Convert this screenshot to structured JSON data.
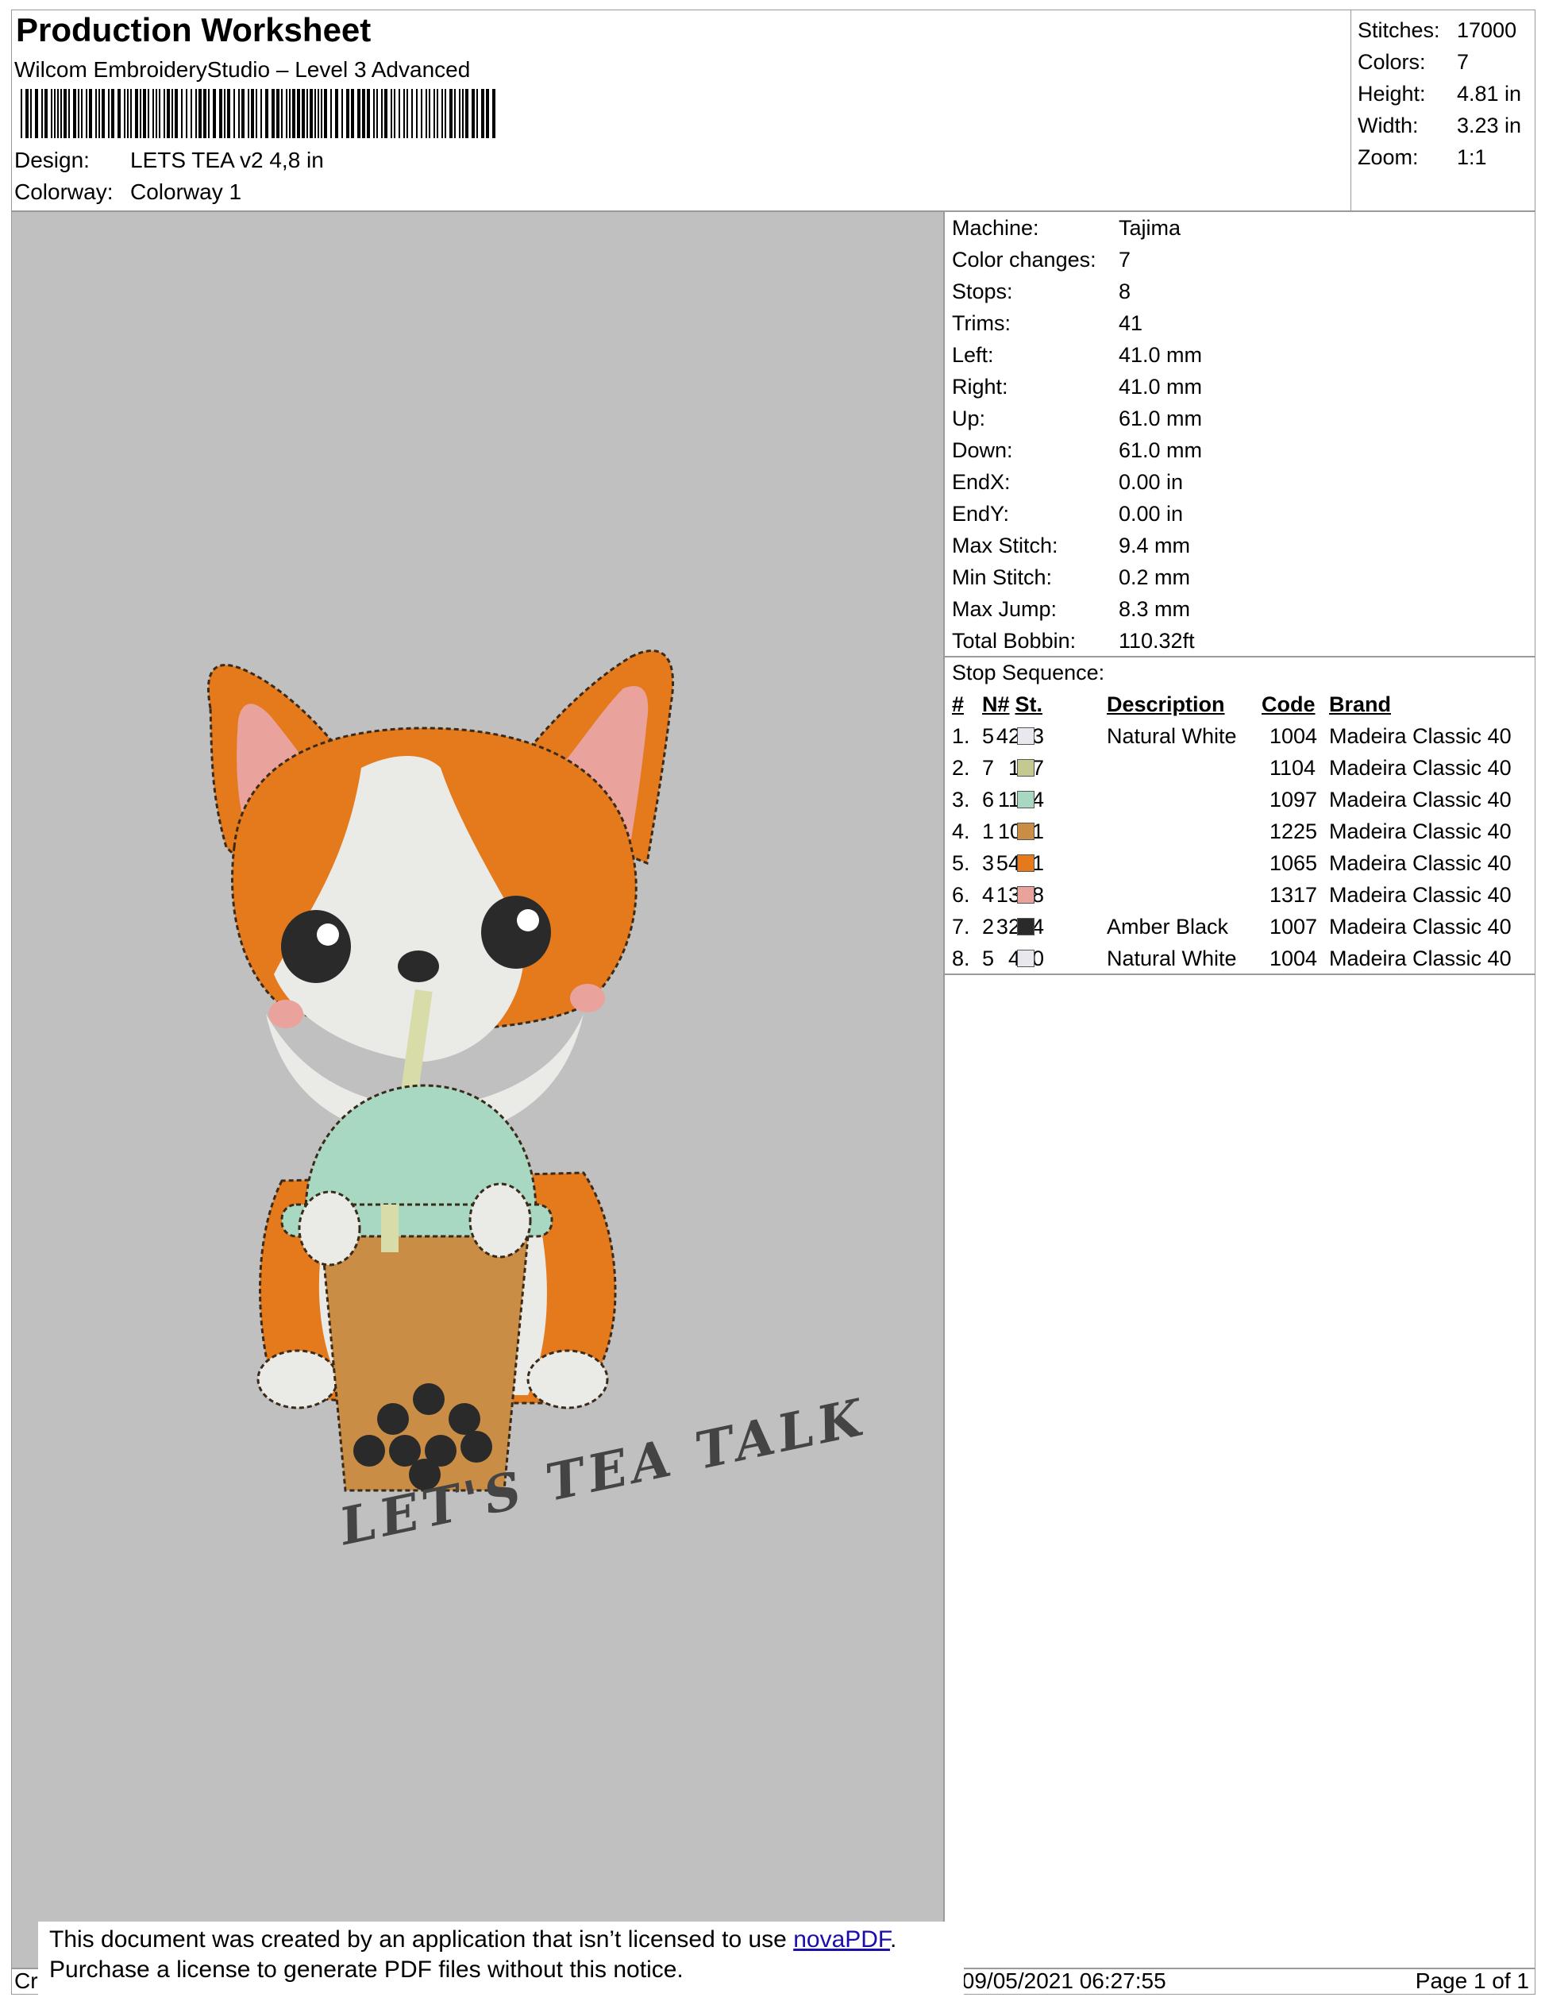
{
  "header": {
    "title": "Production Worksheet",
    "software": "Wilcom EmbroideryStudio – Level 3 Advanced",
    "design_label": "Design:",
    "design_value": "LETS TEA v2 4,8 in",
    "colorway_label": "Colorway:",
    "colorway_value": "Colorway 1"
  },
  "summary": [
    {
      "label": "Stitches:",
      "value": "17000"
    },
    {
      "label": "Colors:",
      "value": "7"
    },
    {
      "label": "Height:",
      "value": "4.81 in"
    },
    {
      "label": "Width:",
      "value": "3.23 in"
    },
    {
      "label": "Zoom:",
      "value": "1:1"
    }
  ],
  "machine_info": [
    {
      "label": "Machine:",
      "value": "Tajima"
    },
    {
      "label": "Color changes:",
      "value": "7"
    },
    {
      "label": "Stops:",
      "value": "8"
    },
    {
      "label": "Trims:",
      "value": "41"
    },
    {
      "label": "Left:",
      "value": "41.0 mm"
    },
    {
      "label": "Right:",
      "value": "41.0 mm"
    },
    {
      "label": "Up:",
      "value": "61.0 mm"
    },
    {
      "label": "Down:",
      "value": "61.0 mm"
    },
    {
      "label": "EndX:",
      "value": "0.00 in"
    },
    {
      "label": "EndY:",
      "value": "0.00 in"
    },
    {
      "label": "Max Stitch:",
      "value": "9.4 mm"
    },
    {
      "label": "Min Stitch:",
      "value": "0.2 mm"
    },
    {
      "label": "Max Jump:",
      "value": "8.3 mm"
    },
    {
      "label": "Total Bobbin:",
      "value": "110.32ft"
    }
  ],
  "stop_sequence": {
    "title": "Stop Sequence:",
    "headers": {
      "num": "#",
      "n": "N#",
      "st": "St.",
      "desc": "Description",
      "code": "Code",
      "brand": "Brand"
    },
    "rows": [
      {
        "num": "1.",
        "n": "5",
        "color": "#e8e8ee",
        "st": "4213",
        "desc": "Natural White",
        "code": "1004",
        "brand": "Madeira Classic 40"
      },
      {
        "num": "2.",
        "n": "7",
        "color": "#c3c98f",
        "st": "137",
        "desc": "",
        "code": "1104",
        "brand": "Madeira Classic 40"
      },
      {
        "num": "3.",
        "n": "6",
        "color": "#a9d8c2",
        "st": "1134",
        "desc": "",
        "code": "1097",
        "brand": "Madeira Classic 40"
      },
      {
        "num": "4.",
        "n": "1",
        "color": "#c98d45",
        "st": "1011",
        "desc": "",
        "code": "1225",
        "brand": "Madeira Classic 40"
      },
      {
        "num": "5.",
        "n": "3",
        "color": "#e57a1c",
        "st": "5471",
        "desc": "",
        "code": "1065",
        "brand": "Madeira Classic 40"
      },
      {
        "num": "6.",
        "n": "4",
        "color": "#e9a39c",
        "st": "1388",
        "desc": "",
        "code": "1317",
        "brand": "Madeira Classic 40"
      },
      {
        "num": "7.",
        "n": "2",
        "color": "#2a2a2a",
        "st": "3214",
        "desc": "Amber Black",
        "code": "1007",
        "brand": "Madeira Classic 40"
      },
      {
        "num": "8.",
        "n": "5",
        "color": "#e8e8ee",
        "st": "430",
        "desc": "Natural White",
        "code": "1004",
        "brand": "Madeira Classic 40"
      }
    ]
  },
  "design_text": "LET'S TEA TALK",
  "footer": {
    "notice_line1": "This document was created by an application that isn’t licensed to use ",
    "notice_link": "novaPDF",
    "notice_line1_end": ".",
    "notice_line2": "Purchase a license to generate PDF files without this notice.",
    "left_fragment": "Cr",
    "date_fragment": "l: 09/05/2021 06:27:55",
    "page": "Page 1 of 1"
  },
  "colors": {
    "canvas_bg": "#c0c0c0",
    "corgi_orange": "#e57a1c",
    "cup_mint": "#a9d8c2",
    "tea_brown": "#c98d45"
  }
}
